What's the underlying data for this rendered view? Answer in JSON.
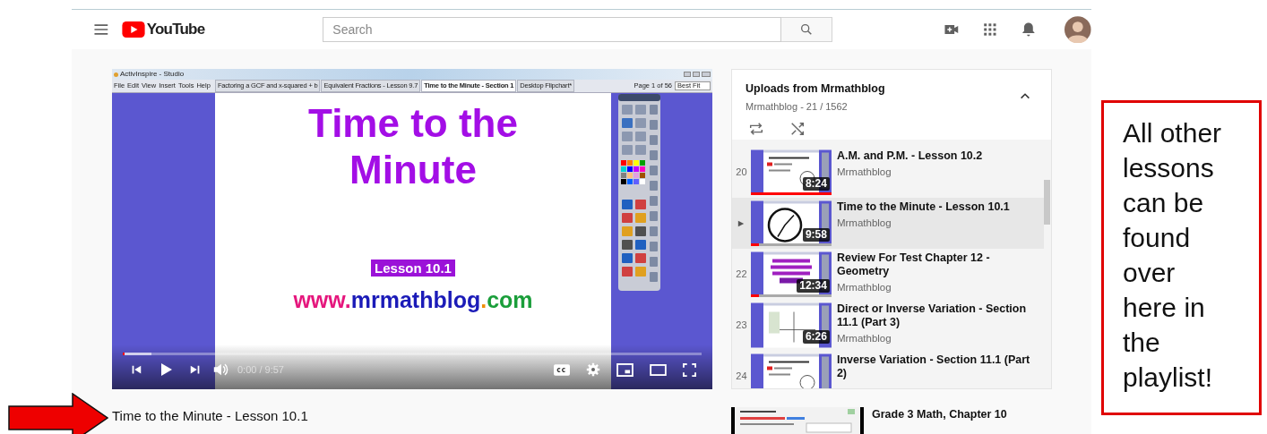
{
  "header": {
    "logo_text": "YouTube",
    "search": {
      "placeholder": "Search"
    }
  },
  "player": {
    "app_window": {
      "title": "ActivInspire - Studio",
      "menu": [
        "File",
        "Edit",
        "View",
        "Insert",
        "Tools",
        "Help"
      ],
      "tabs": [
        {
          "label": "Factoring a GCF and  x-squared + b",
          "selected": false
        },
        {
          "label": "Equivalent Fractions - Lesson 9.7",
          "selected": false
        },
        {
          "label": "Time to the Minute - Section 1",
          "selected": true
        },
        {
          "label": "Desktop Flipchart*",
          "selected": false
        }
      ],
      "page_label": "Page 1 of 56",
      "zoom_value": "Best Fit"
    },
    "slide": {
      "title_lines": [
        "Time to the",
        "Minute"
      ],
      "badge": "Lesson 10.1",
      "url_parts": [
        {
          "text": "www.",
          "color": "#e5177d"
        },
        {
          "text": "mrmathblog",
          "color": "#1b1bb8"
        },
        {
          "text": ".",
          "color": "#f08c00"
        },
        {
          "text": "com",
          "color": "#1a9e3a"
        }
      ]
    },
    "controls": {
      "time": "0:00 / 9:57",
      "progress": {
        "level": 0.05
      }
    }
  },
  "video_title": "Time to the Minute - Lesson 10.1",
  "playlist": {
    "title": "Uploads from Mrmathblog",
    "subtitle": "Mrmathblog - 21 / 1562",
    "expanded": true,
    "items": [
      {
        "index": "20",
        "title": "A.M. and P.M. - Lesson 10.2",
        "channel": "Mrmathblog",
        "duration": "8:24",
        "level": 1,
        "selected": false
      },
      {
        "title": "Time to the Minute - Lesson 10.1",
        "channel": "Mrmathblog",
        "duration": "9:58",
        "level": 0.1,
        "selected": true
      },
      {
        "index": "22",
        "title": "Review For Test Chapter 12 - Geometry",
        "channel": "Mrmathblog",
        "duration": "12:34",
        "level": 0.1,
        "selected": false
      },
      {
        "index": "23",
        "title": "Direct or Inverse Variation - Section 11.1 (Part 3)",
        "channel": "Mrmathblog",
        "duration": "6:26",
        "selected": false
      },
      {
        "index": "24",
        "title": "Inverse Variation - Section 11.1 (Part 2)",
        "selected": false
      }
    ]
  },
  "next_video": {
    "title": "Grade 3 Math, Chapter 10"
  },
  "annotation": {
    "callout": "All other lessons can be found over here in the playlist!"
  }
}
